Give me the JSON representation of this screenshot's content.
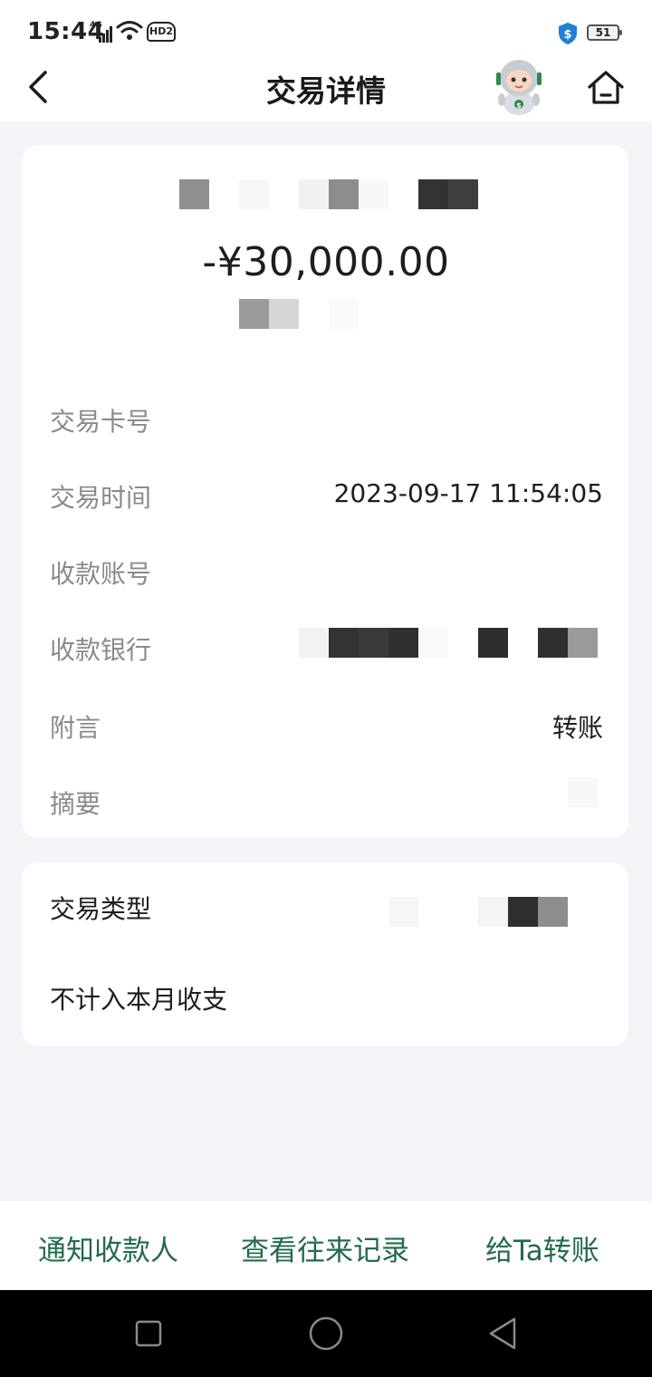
{
  "status_bar": {
    "time": "15:44",
    "network": "4G",
    "hd_label": "HD2",
    "battery": "51"
  },
  "nav": {
    "title": "交易详情"
  },
  "summary": {
    "amount": "-¥30,000.00"
  },
  "details": {
    "card_no_label": "交易卡号",
    "time_label": "交易时间",
    "time_value": "2023-09-17 11:54:05",
    "payee_account_label": "收款账号",
    "payee_bank_label": "收款银行",
    "note_label": "附言",
    "note_value": "转账",
    "summary_label": "摘要"
  },
  "extra": {
    "type_label": "交易类型",
    "exclude_label": "不计入本月收支"
  },
  "actions": {
    "notify": "通知收款人",
    "history": "查看往来记录",
    "transfer": "给Ta转账"
  },
  "colors": {
    "accent": "#236b4a",
    "page_bg": "#f3f3f8",
    "label_gray": "#8a8a8e"
  }
}
